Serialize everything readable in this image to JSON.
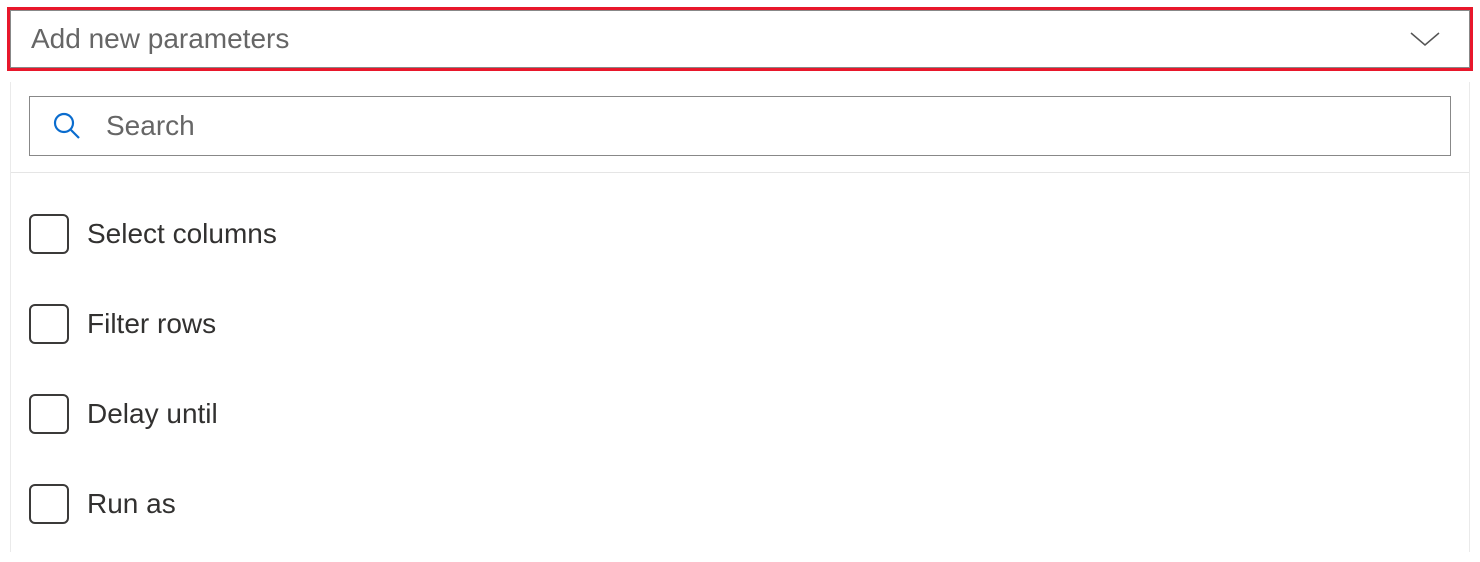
{
  "dropdown": {
    "placeholder": "Add new parameters"
  },
  "search": {
    "placeholder": "Search"
  },
  "options": [
    {
      "label": "Select columns"
    },
    {
      "label": "Filter rows"
    },
    {
      "label": "Delay until"
    },
    {
      "label": "Run as"
    }
  ]
}
